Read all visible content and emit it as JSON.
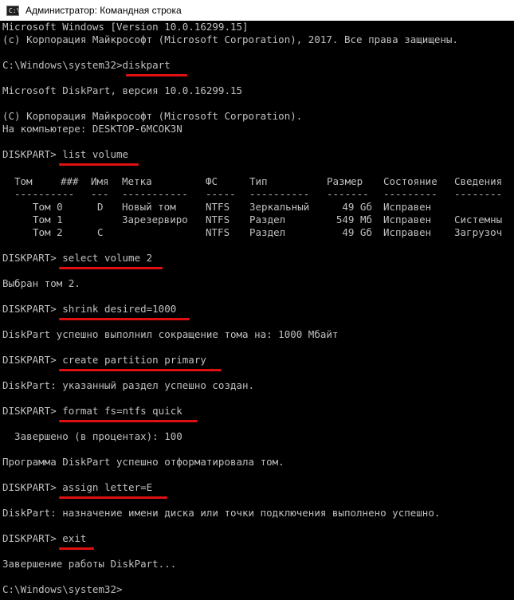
{
  "window": {
    "title": "Администратор: Командная строка",
    "icon_text": "C:\\"
  },
  "header": [
    "Microsoft Windows [Version 10.0.16299.15]",
    "(c) Корпорация Майкрософт (Microsoft Corporation), 2017. Все права защищены."
  ],
  "prompt_path": "C:\\Windows\\system32>",
  "diskpart_prompt": "DISKPART> ",
  "commands": {
    "diskpart": "diskpart",
    "list_volume": "list volume",
    "select_volume": "select volume 2",
    "shrink": "shrink desired=1000",
    "create_partition": "create partition primary",
    "format": "format fs=ntfs quick",
    "assign": "assign letter=E",
    "exit": "exit"
  },
  "diskpart_info": [
    "Microsoft DiskPart, версия 10.0.16299.15",
    "(C) Корпорация Майкрософт (Microsoft Corporation).",
    "На компьютере: DESKTOP-6MCOK3N"
  ],
  "volume_table": {
    "headers": [
      "Том",
      "###",
      "Имя",
      "Метка",
      "ФС",
      "Тип",
      "Размер",
      "Состояние",
      "Сведения"
    ],
    "dashes": [
      "----------",
      "---",
      "-----------",
      "-----",
      "----------",
      "-------",
      "---------",
      "--------"
    ],
    "rows": [
      [
        "Том 0",
        "D",
        "Новый том",
        "NTFS",
        "Зеркальный",
        "49 Gб",
        "Исправен",
        ""
      ],
      [
        "Том 1",
        "",
        "Зарезервиро",
        "NTFS",
        "Раздел",
        "549 Mб",
        "Исправен",
        "Системны"
      ],
      [
        "Том 2",
        "C",
        "",
        "NTFS",
        "Раздел",
        "49 Gб",
        "Исправен",
        "Загрузоч"
      ]
    ]
  },
  "outputs": {
    "select": "Выбран том 2.",
    "shrink": "DiskPart успешно выполнил сокращение тома на: 1000 Мбайт",
    "create": "DiskPart: указанный раздел успешно создан.",
    "format_progress": "  Завершено (в процентах): 100",
    "format_done": "Программа DiskPart успешно отформатировала том.",
    "assign": "DiskPart: назначение имени диска или точки подключения выполнено успешно.",
    "exit": "Завершение работы DiskPart..."
  },
  "colors": {
    "text": "#c0c0c0",
    "background": "#000000",
    "underline": "#e01010"
  }
}
